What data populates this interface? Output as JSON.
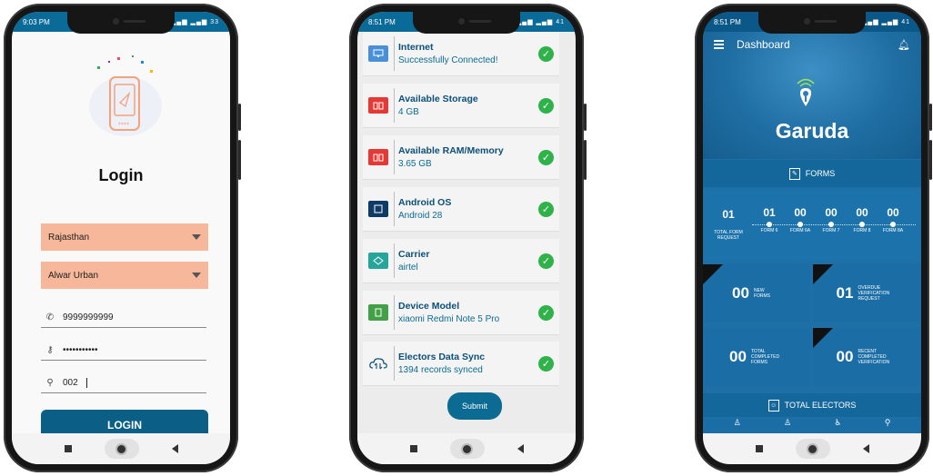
{
  "login_screen": {
    "status_time": "9:03 PM",
    "status_icons": "▂▄▆ ▂▄▆ 33",
    "title": "Login",
    "state_value": "Rajasthan",
    "district_value": "Alwar Urban",
    "phone_value": "9999999999",
    "password_value": "•••••••••••",
    "code_value": "002",
    "login_label": "LOGIN"
  },
  "check_screen": {
    "status_time": "8:51 PM",
    "status_icons": "▂▄▆ ▂▄▆ 41",
    "items": [
      {
        "title": "Internet",
        "value": "Successfully Connected!"
      },
      {
        "title": "Available Storage",
        "value": "4 GB"
      },
      {
        "title": "Available RAM/Memory",
        "value": "3.65 GB"
      },
      {
        "title": "Android OS",
        "value": "Android 28"
      },
      {
        "title": "Carrier",
        "value": "airtel"
      },
      {
        "title": "Device Model",
        "value": "xiaomi Redmi Note 5 Pro"
      },
      {
        "title": "Electors Data Sync",
        "value": "1394 records synced"
      }
    ],
    "submit_label": "Submit"
  },
  "dash_screen": {
    "status_time": "8:51 PM",
    "status_icons": "▂▄▆ ▂▄▆ 41",
    "header_title": "Dashboard",
    "brand": "Garuda",
    "forms_label": "FORMS",
    "total_request": {
      "value": "01",
      "label": "TOTAL FORM REQUEST"
    },
    "form_counts": [
      {
        "value": "01",
        "label": "FORM 6"
      },
      {
        "value": "00",
        "label": "FORM 6A"
      },
      {
        "value": "00",
        "label": "FORM 7"
      },
      {
        "value": "00",
        "label": "FORM 8"
      },
      {
        "value": "00",
        "label": "FORM 8A"
      }
    ],
    "tiles": [
      {
        "value": "00",
        "label": "NEW FORMS"
      },
      {
        "value": "01",
        "label": "OVERDUE VERIFICATION REQUEST"
      },
      {
        "value": "00",
        "label": "TOTAL COMPLETED FORMS"
      },
      {
        "value": "00",
        "label": "RECENT COMPLETED VERIFICATION"
      }
    ],
    "total_electors_label": "TOTAL ELECTORS"
  },
  "colors": {
    "accent": "#0b5e86",
    "dropdown": "#f6b79a",
    "success": "#2fb24a",
    "dashboard_bg": "#1e6fa6"
  }
}
